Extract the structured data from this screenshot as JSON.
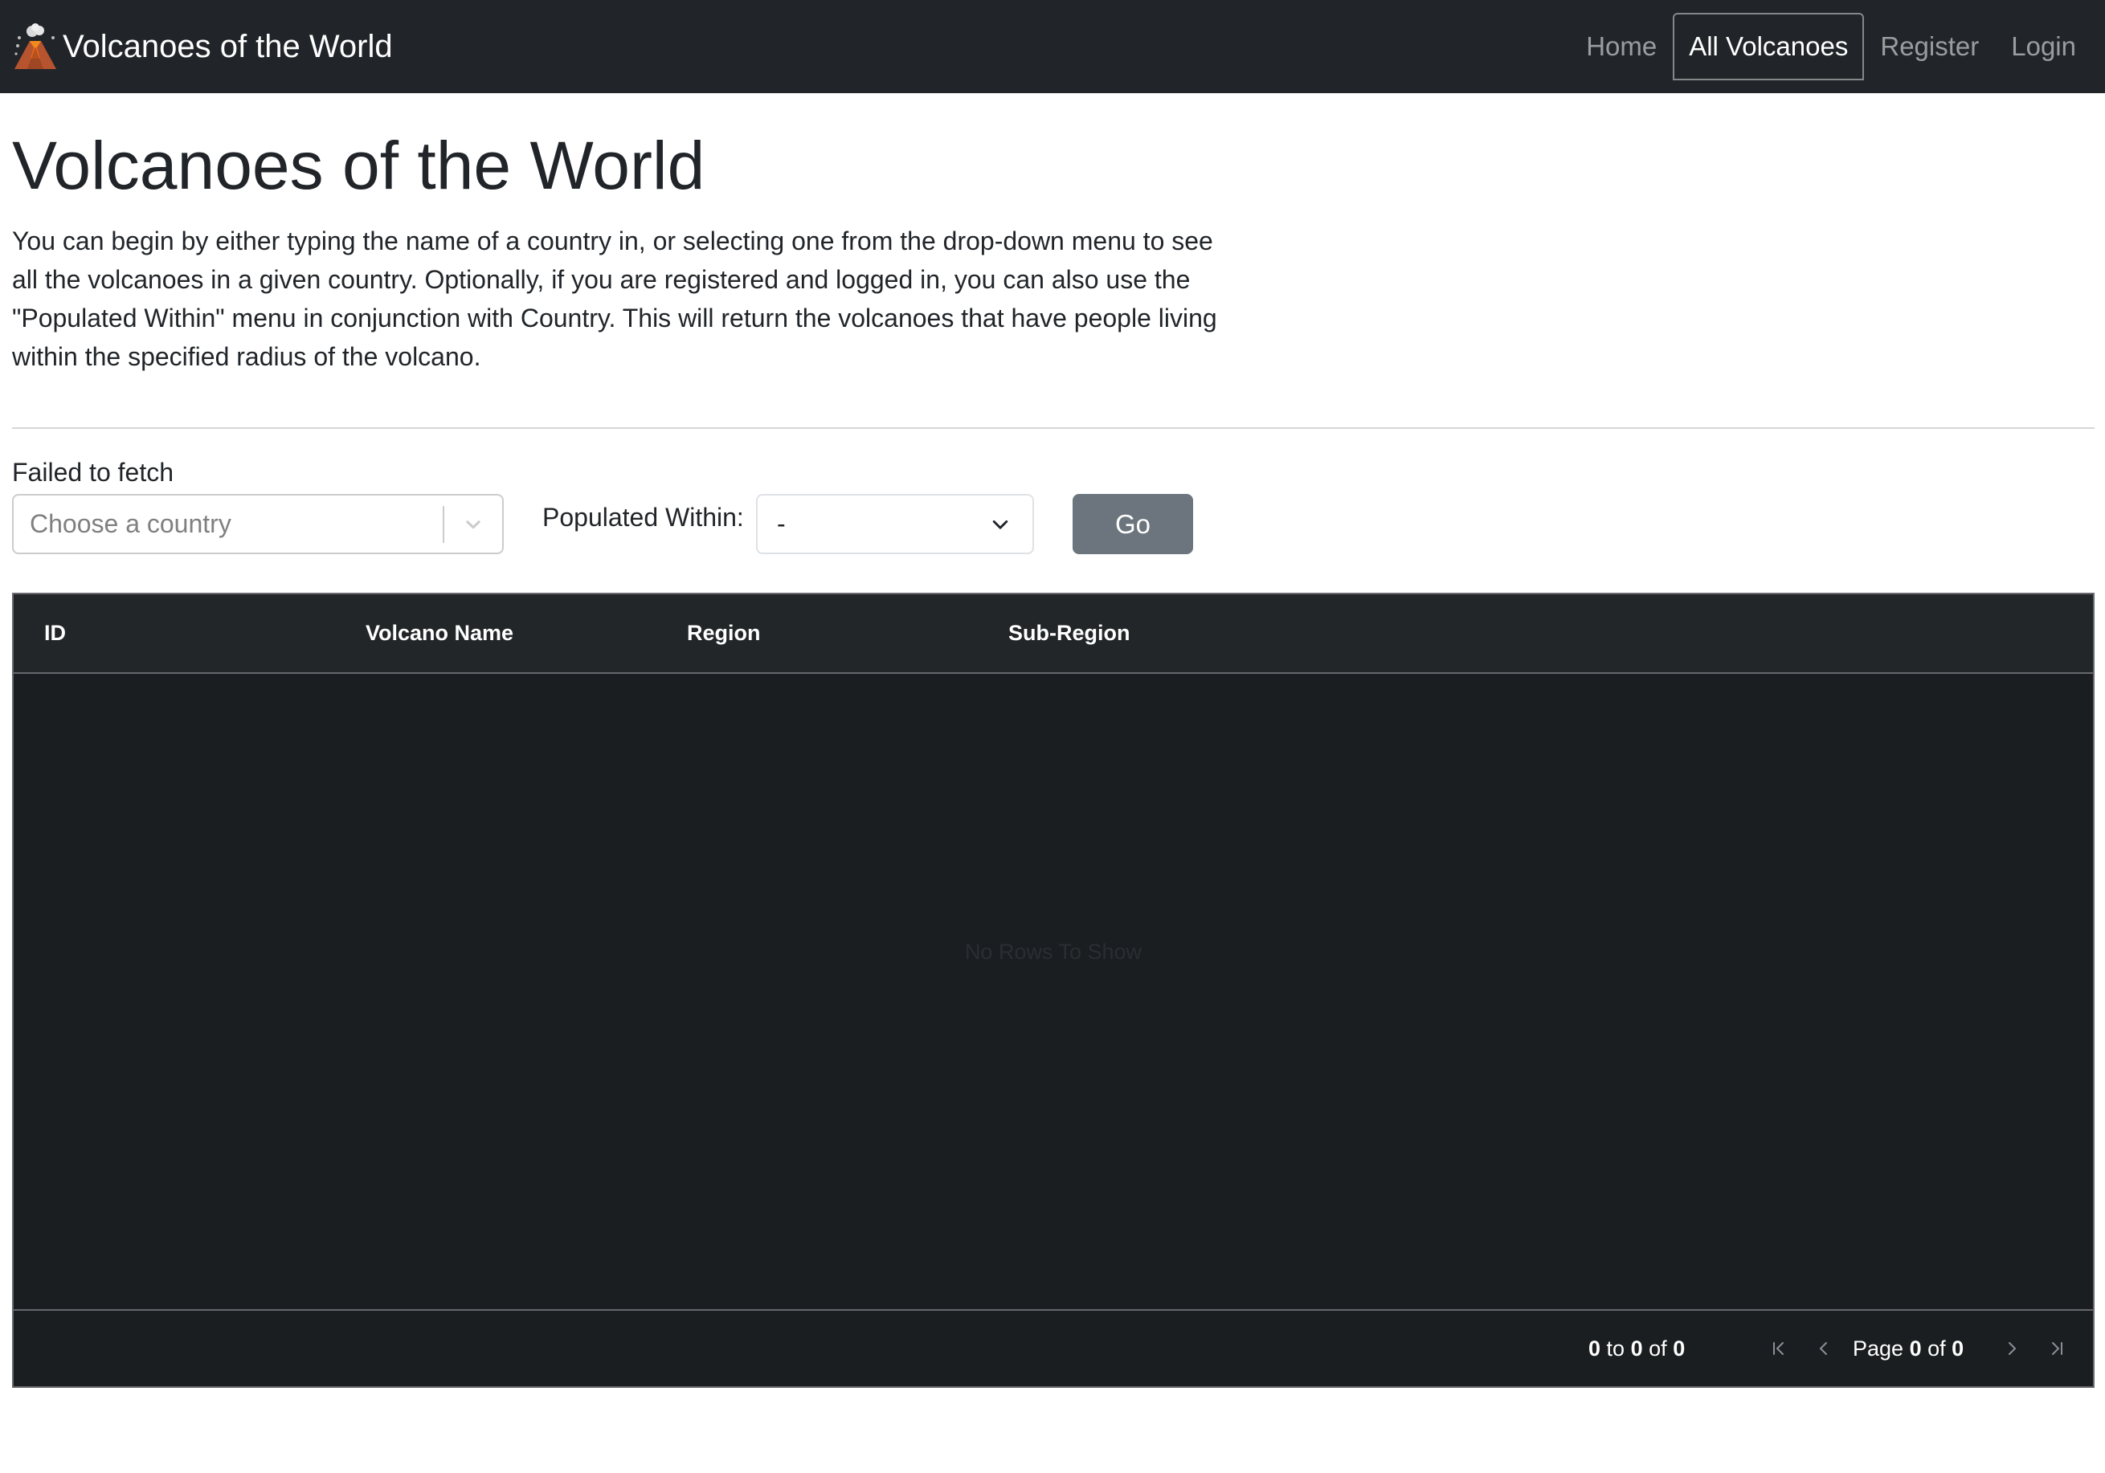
{
  "navbar": {
    "brand_text": "Volcanoes of the World",
    "links": [
      {
        "label": "Home",
        "active": false
      },
      {
        "label": "All Volcanoes",
        "active": true
      },
      {
        "label": "Register",
        "active": false
      },
      {
        "label": "Login",
        "active": false
      }
    ]
  },
  "page": {
    "title": "Volcanoes of the World",
    "intro": "You can begin by either typing the name of a country in, or selecting one from the drop-down menu to see all the volcanoes in a given country. Optionally, if you are registered and logged in, you can also use the \"Populated Within\" menu in conjunction with Country. This will return the volcanoes that have people living within the specified radius of the volcano."
  },
  "controls": {
    "fetch_error": "Failed to fetch",
    "country_placeholder": "Choose a country",
    "populated_label": "Populated Within:",
    "populated_value": "-",
    "go_label": "Go"
  },
  "grid": {
    "columns": [
      "ID",
      "Volcano Name",
      "Region",
      "Sub-Region"
    ],
    "rows": [],
    "empty_message": "No Rows To Show",
    "footer": {
      "row_from": "0",
      "to_word": "to",
      "row_to": "0",
      "of_word": "of",
      "row_total": "0",
      "page_word": "Page",
      "page_current": "0",
      "page_of_word": "of",
      "page_total": "0"
    }
  },
  "colors": {
    "navbar_bg": "#212529",
    "grid_bg": "#1b1e20",
    "go_button": "#6c757d"
  },
  "icons": {
    "brand": "volcano-icon",
    "country_dropdown": "chevron-down-icon",
    "populated_dropdown": "chevron-down-icon",
    "pager": [
      "first-page-icon",
      "previous-page-icon",
      "next-page-icon",
      "last-page-icon"
    ]
  }
}
